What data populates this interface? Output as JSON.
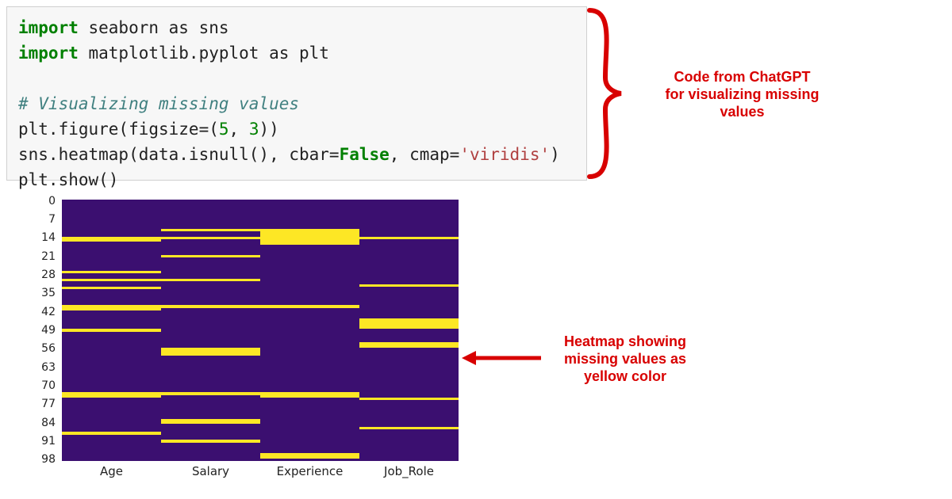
{
  "code": {
    "line1_kw": "import",
    "line1_rest": " seaborn as sns",
    "line2_kw": "import",
    "line2_rest": " matplotlib.pyplot as plt",
    "line3_blank": "",
    "line4_comment": "# Visualizing missing values",
    "line5_a": "plt.figure(figsize=(",
    "line5_n1": "5",
    "line5_b": ", ",
    "line5_n2": "3",
    "line5_c": "))",
    "line6_a": "sns.heatmap(data.isnull(), cbar=",
    "line6_false": "False",
    "line6_b": ", cmap=",
    "line6_str": "'viridis'",
    "line6_c": ")",
    "line7": "plt.show()"
  },
  "annotations": {
    "code_label_l1": "Code from ChatGPT",
    "code_label_l2": "for visualizing missing",
    "code_label_l3": "values",
    "heatmap_label_l1": "Heatmap showing",
    "heatmap_label_l2": "missing values as",
    "heatmap_label_l3": "yellow color"
  },
  "chart_data": {
    "type": "heatmap",
    "title": "",
    "xlabel": "",
    "ylabel": "",
    "x_categories": [
      "Age",
      "Salary",
      "Experience",
      "Job_Role"
    ],
    "y_ticks": [
      0,
      7,
      14,
      21,
      28,
      35,
      42,
      49,
      56,
      63,
      70,
      77,
      84,
      91,
      98
    ],
    "n_rows": 99,
    "colormap": "viridis",
    "colors": {
      "present": "#3b0f70",
      "missing": "#fde725"
    },
    "missing_rows_by_column": {
      "Age": [
        14,
        15,
        27,
        30,
        33,
        40,
        41,
        49,
        73,
        74,
        88
      ],
      "Salary": [
        11,
        14,
        21,
        30,
        40,
        56,
        57,
        58,
        73,
        83,
        84,
        91
      ],
      "Experience": [
        11,
        12,
        13,
        14,
        15,
        16,
        40,
        73,
        74,
        96,
        97
      ],
      "Job_Role": [
        14,
        32,
        45,
        46,
        47,
        48,
        54,
        55,
        75,
        86
      ]
    }
  }
}
